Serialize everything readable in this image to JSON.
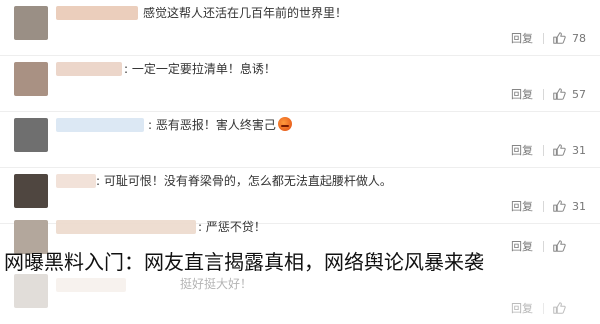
{
  "comments": [
    {
      "text": "感觉这帮人还活在几百年前的世界里！",
      "reply_label": "回复",
      "likes": "78",
      "avatar_color": "#9a8f85",
      "name_color": "#e9c9b5"
    },
    {
      "text": ": 一定一定要拉清单！息诱！",
      "reply_label": "回复",
      "likes": "57",
      "avatar_color": "#a99183",
      "name_color": "#ead2c4"
    },
    {
      "text": ": 恶有恶报！害人终害己",
      "reply_label": "回复",
      "likes": "31",
      "avatar_color": "#6f6f6f",
      "name_color": "#d8e6f3"
    },
    {
      "text": ": 可耻可恨！没有脊梁骨的，怎么都无法直起腰杆做人。",
      "reply_label": "回复",
      "likes": "31",
      "avatar_color": "#4f4640",
      "name_color": "#f1dfd5"
    },
    {
      "text": ": 严惩不贷！",
      "reply_label": "回复",
      "likes": "",
      "avatar_color": "#b3a79c",
      "name_color": "#ecd9cc"
    },
    {
      "text": "挺好挺大好！",
      "reply_label": "回复",
      "likes": "",
      "avatar_color": "#c9c2bb",
      "name_color": "#f0e5de"
    }
  ],
  "caption": "网曝黑料入门：网友直言揭露真相，网络舆论风暴来袭",
  "colors": {
    "like_icon": "#8a8a8a",
    "emoji": "#e14b12"
  },
  "icons": {
    "like": "thumbs-up-icon",
    "emoji": "angry-face-icon"
  }
}
